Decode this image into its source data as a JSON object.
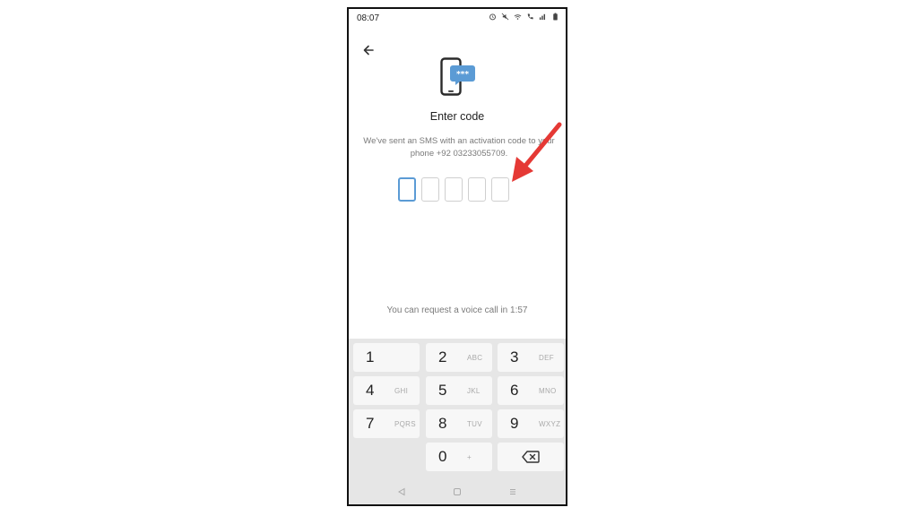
{
  "status": {
    "time": "08:07"
  },
  "icons": {
    "back": "back-arrow-icon",
    "hero": "phone-sms-code-icon",
    "backspace": "backspace-icon"
  },
  "header": {
    "title": "Enter code"
  },
  "description": "We've sent an SMS with an activation code to your phone +92 03233055709.",
  "code_boxes": 5,
  "voice_call_text": "You can request a voice call in 1:57",
  "keypad": {
    "keys": [
      {
        "num": "1",
        "letters": ""
      },
      {
        "num": "2",
        "letters": "ABC"
      },
      {
        "num": "3",
        "letters": "DEF"
      },
      {
        "num": "4",
        "letters": "GHI"
      },
      {
        "num": "5",
        "letters": "JKL"
      },
      {
        "num": "6",
        "letters": "MNO"
      },
      {
        "num": "7",
        "letters": "PQRS"
      },
      {
        "num": "8",
        "letters": "TUV"
      },
      {
        "num": "9",
        "letters": "WXYZ"
      },
      {
        "num": "0",
        "letters": "+"
      }
    ]
  },
  "colors": {
    "accent": "#5b9bd5",
    "annotation_arrow": "#e53935"
  }
}
